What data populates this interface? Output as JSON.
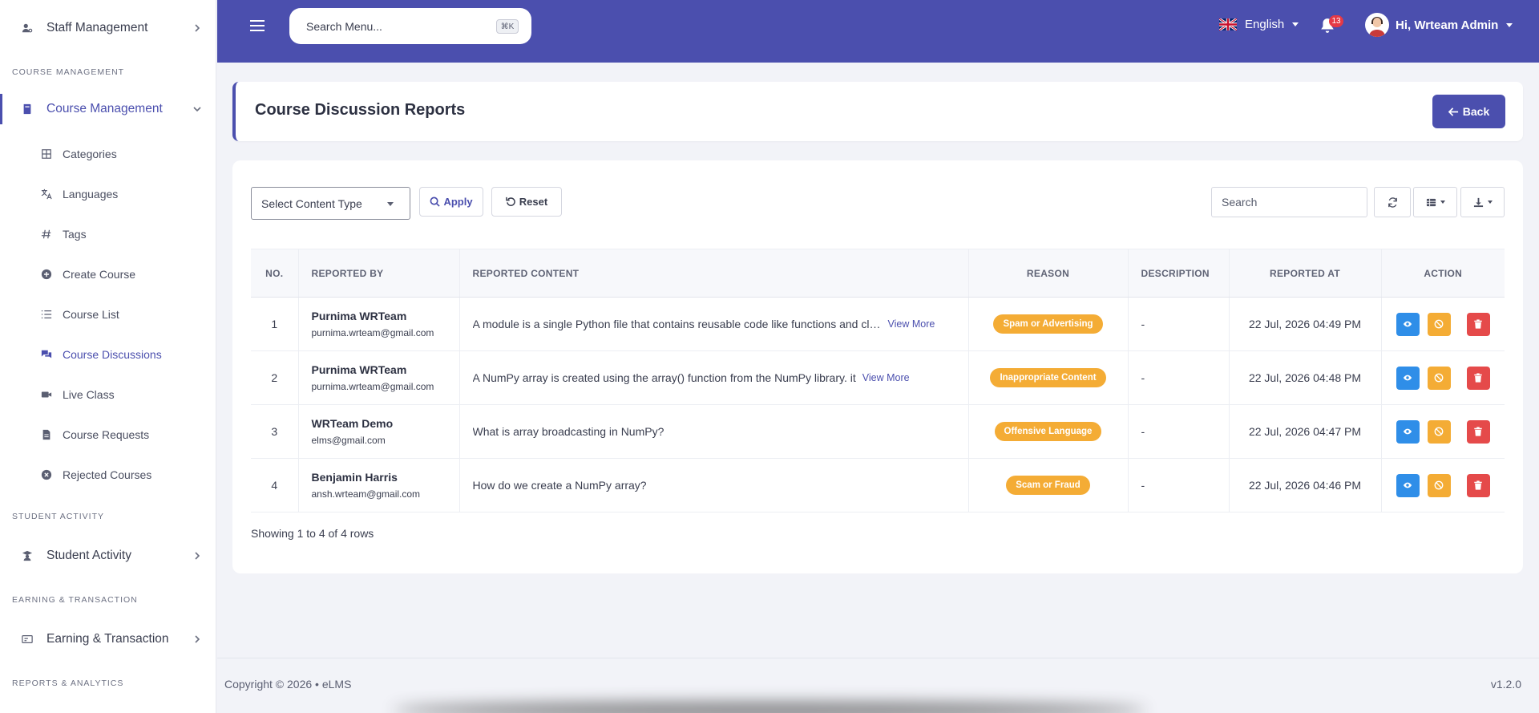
{
  "sidebar": {
    "staff_management": "Staff Management",
    "section_course": "COURSE MANAGEMENT",
    "course_management": "Course Management",
    "sub_items": [
      {
        "label": "Categories",
        "icon": "grid-icon"
      },
      {
        "label": "Languages",
        "icon": "translate-icon"
      },
      {
        "label": "Tags",
        "icon": "hash-icon"
      },
      {
        "label": "Create Course",
        "icon": "plus-circle-icon"
      },
      {
        "label": "Course List",
        "icon": "list-icon"
      },
      {
        "label": "Course Discussions",
        "icon": "chat-icon"
      },
      {
        "label": "Live Class",
        "icon": "video-icon"
      },
      {
        "label": "Course Requests",
        "icon": "file-icon"
      },
      {
        "label": "Rejected Courses",
        "icon": "x-circle-icon"
      }
    ],
    "section_student": "STUDENT ACTIVITY",
    "student_activity": "Student Activity",
    "section_earning": "EARNING & TRANSACTION",
    "earning_transaction": "Earning & Transaction",
    "section_reports": "REPORTS & ANALYTICS"
  },
  "topbar": {
    "search_placeholder": "Search Menu...",
    "shortcut": "⌘K",
    "language": "English",
    "notification_count": "13",
    "user_greeting": "Hi, Wrteam Admin"
  },
  "page": {
    "title": "Course Discussion Reports",
    "back_label": "Back"
  },
  "filters": {
    "content_type": "Select Content Type",
    "apply": "Apply",
    "reset": "Reset",
    "search_placeholder": "Search"
  },
  "table": {
    "headers": {
      "no": "NO.",
      "reported_by": "REPORTED BY",
      "reported_content": "REPORTED CONTENT",
      "reason": "REASON",
      "description": "DESCRIPTION",
      "reported_at": "REPORTED AT",
      "action": "ACTION"
    },
    "rows": [
      {
        "no": "1",
        "name": "Purnima WRTeam",
        "email": "purnima.wrteam@gmail.com",
        "content": "A module is a single Python file that contains reusable code like functions and classes",
        "view_more": "View More",
        "reason": "Spam or Advertising",
        "description": "-",
        "reported_at": "22 Jul, 2026 04:49 PM"
      },
      {
        "no": "2",
        "name": "Purnima WRTeam",
        "email": "purnima.wrteam@gmail.com",
        "content": "A NumPy array is created using the array() function from the NumPy library. it",
        "view_more": "View More",
        "reason": "Inappropriate Content",
        "description": "-",
        "reported_at": "22 Jul, 2026 04:48 PM"
      },
      {
        "no": "3",
        "name": "WRTeam Demo",
        "email": "elms@gmail.com",
        "content": "What is array broadcasting in NumPy?",
        "view_more": "",
        "reason": "Offensive Language",
        "description": "-",
        "reported_at": "22 Jul, 2026 04:47 PM"
      },
      {
        "no": "4",
        "name": "Benjamin Harris",
        "email": "ansh.wrteam@gmail.com",
        "content": "How do we create a NumPy array?",
        "view_more": "",
        "reason": "Scam or Fraud",
        "description": "-",
        "reported_at": "22 Jul, 2026 04:46 PM"
      }
    ],
    "showing": "Showing 1 to 4 of 4 rows"
  },
  "footer": {
    "copyright": "Copyright © 2026  •  eLMS",
    "version": "v1.2.0"
  },
  "colors": {
    "brand": "#4b4fae",
    "badge": "#f4ac35",
    "view": "#2f8ee8",
    "delete": "#e54a4a",
    "notification": "#e53946"
  }
}
